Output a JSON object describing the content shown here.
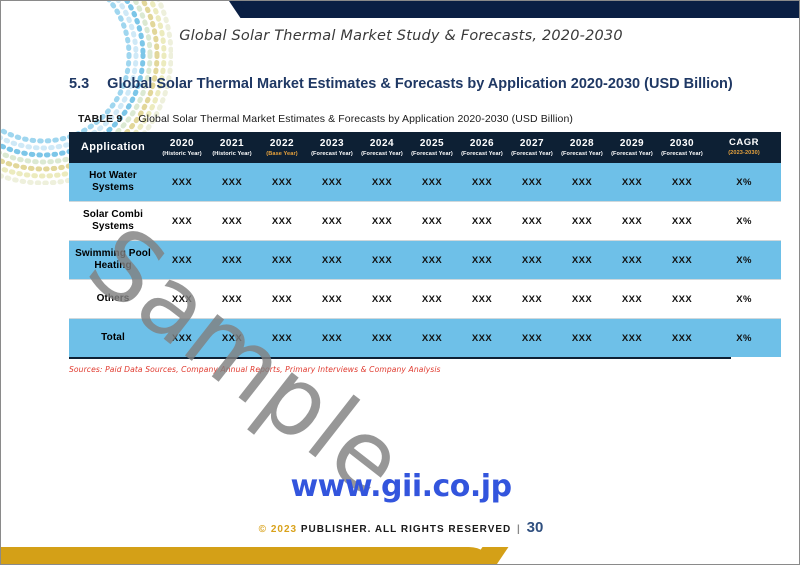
{
  "document": {
    "header_title": "Global Solar Thermal Market Study & Forecasts, 2020-2030",
    "section_number": "5.3",
    "section_title": "Global Solar Thermal Market Estimates & Forecasts by Application 2020-2030 (USD Billion)"
  },
  "table": {
    "caption_label": "TABLE 9",
    "caption_text": "Global Solar Thermal Market Estimates & Forecasts by Application 2020-2030 (USD Billion)",
    "columns": [
      {
        "key": "application",
        "year": "Application",
        "sub": ""
      },
      {
        "key": "y2020",
        "year": "2020",
        "sub": "(Historic Year)"
      },
      {
        "key": "y2021",
        "year": "2021",
        "sub": "(Historic Year)"
      },
      {
        "key": "y2022",
        "year": "2022",
        "sub": "(Base Year)",
        "sub_highlight": true
      },
      {
        "key": "y2023",
        "year": "2023",
        "sub": "(Forecast Year)"
      },
      {
        "key": "y2024",
        "year": "2024",
        "sub": "(Forecast Year)"
      },
      {
        "key": "y2025",
        "year": "2025",
        "sub": "(Forecast Year)"
      },
      {
        "key": "y2026",
        "year": "2026",
        "sub": "(Forecast Year)"
      },
      {
        "key": "y2027",
        "year": "2027",
        "sub": "(Forecast Year)"
      },
      {
        "key": "y2028",
        "year": "2028",
        "sub": "(Forecast Year)"
      },
      {
        "key": "y2029",
        "year": "2029",
        "sub": "(Forecast Year)"
      },
      {
        "key": "y2030",
        "year": "2030",
        "sub": "(Forecast Year)"
      },
      {
        "key": "cagr",
        "year": "CAGR",
        "sub": "(2023-2030)",
        "sub_highlight": true
      }
    ],
    "rows": [
      {
        "label": "Hot Water Systems",
        "shaded": true,
        "values": [
          "XXX",
          "XXX",
          "XXX",
          "XXX",
          "XXX",
          "XXX",
          "XXX",
          "XXX",
          "XXX",
          "XXX",
          "XXX"
        ],
        "cagr": "X%"
      },
      {
        "label": "Solar Combi Systems",
        "shaded": false,
        "values": [
          "XXX",
          "XXX",
          "XXX",
          "XXX",
          "XXX",
          "XXX",
          "XXX",
          "XXX",
          "XXX",
          "XXX",
          "XXX"
        ],
        "cagr": "X%"
      },
      {
        "label": "Swimming Pool Heating",
        "shaded": true,
        "values": [
          "XXX",
          "XXX",
          "XXX",
          "XXX",
          "XXX",
          "XXX",
          "XXX",
          "XXX",
          "XXX",
          "XXX",
          "XXX"
        ],
        "cagr": "X%"
      },
      {
        "label": "Others",
        "shaded": false,
        "values": [
          "XXX",
          "XXX",
          "XXX",
          "XXX",
          "XXX",
          "XXX",
          "XXX",
          "XXX",
          "XXX",
          "XXX",
          "XXX"
        ],
        "cagr": "X%"
      },
      {
        "label": "Total",
        "shaded": true,
        "values": [
          "XXX",
          "XXX",
          "XXX",
          "XXX",
          "XXX",
          "XXX",
          "XXX",
          "XXX",
          "XXX",
          "XXX",
          "XXX"
        ],
        "cagr": "X%"
      }
    ],
    "source_note": "Sources: Paid Data Sources, Company Annual Reports, Primary Interviews & Company Analysis"
  },
  "watermark": {
    "text": "Sample"
  },
  "footer": {
    "site_url": "www.gii.co.jp",
    "copyright_symbol": "©",
    "copyright_year": "2023",
    "copyright_text": "PUBLISHER. ALL RIGHTS RESERVED",
    "separator": "|",
    "page_number": "30"
  },
  "colors": {
    "navy": "#0a1f44",
    "table_header": "#0d2034",
    "row_shade": "#6ec0e8",
    "gold": "#d4a017",
    "accent_gold_text": "#e8a33d",
    "heading_blue": "#1f3864",
    "url_blue": "#3355dd",
    "source_red": "#e03a2f"
  }
}
